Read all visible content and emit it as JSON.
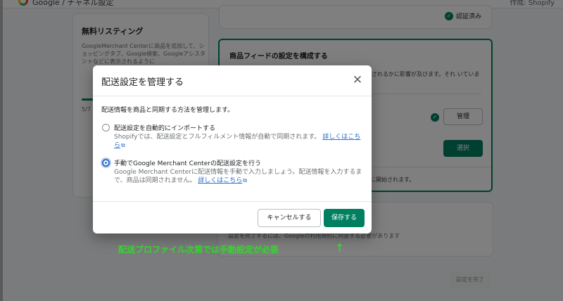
{
  "topbar": {
    "title": "Google / チャネル設定",
    "author": "作成: Shopify"
  },
  "left_card": {
    "title": "無料リスティング",
    "description": "GoogleMerchant Centerに商品を追加して、ショッピングタブ、Google検索、Googleアシスタントなどに表示されるように",
    "progress_label": "5/7",
    "progress_fraction": 0.1
  },
  "verified_card": {
    "status": "認証済み"
  },
  "feed_card": {
    "title": "商品フィードの設定を構成する",
    "description": "表示されるかに影響が及びます。それ いています。",
    "manage_label": "管理",
    "select_label": "選択",
    "footer_text": "動的に開始されます。"
  },
  "bottom_card": {
    "text": "設定を完了するには、Googleの利用規約に同意する必要があります"
  },
  "complete_label": "設定を完了",
  "modal": {
    "title": "配送設定を管理する",
    "intro": "配送情報を商品と同期する方法を管理します。",
    "options": [
      {
        "label": "配送設定を自動的にインポートする",
        "help": "Shopifyでは、配送設定とフルフィルメント情報が自動で同期されます。",
        "link": "詳しくはこちら",
        "selected": false
      },
      {
        "label": "手動でGoogle Merchant Centerの配送設定を行う",
        "help": "Google Merchant Centerに配送情報を手動で入力しましょう。配送情報を入力するまで、商品は同期されません。",
        "link": "詳しくはこちら",
        "selected": true
      }
    ],
    "cancel_label": "キャンセルする",
    "save_label": "保存する"
  },
  "annotation": {
    "text": "配送プロファイル次第では手動設定が必要",
    "arrow": "↑"
  },
  "colors": {
    "primary_green": "#008060",
    "link_blue": "#2c6ecb",
    "annotation_green": "#33d62b"
  },
  "icons": {
    "close": "close-icon",
    "external_link": "external-link-icon",
    "checkmark": "checkmark-icon",
    "google_logo": "google-logo-icon"
  }
}
